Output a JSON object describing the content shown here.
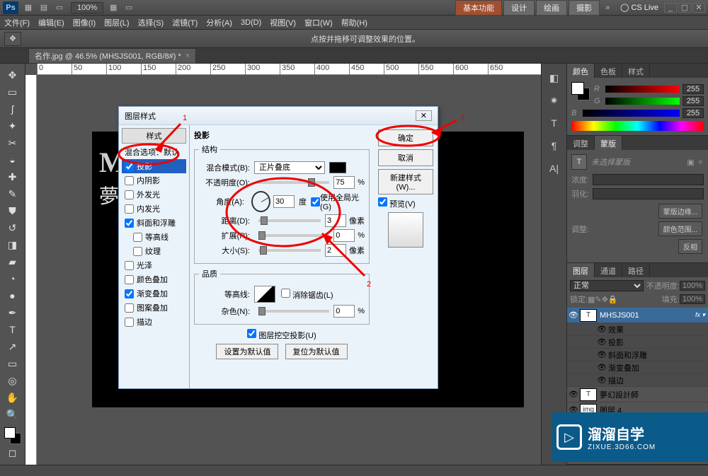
{
  "topbar": {
    "zoom": "100%",
    "cslive": "CS Live"
  },
  "topbar_buttons": {
    "basic": "基本功能",
    "design": "设计",
    "draw": "绘画",
    "photo": "摄影"
  },
  "menu": [
    "文件(F)",
    "编辑(E)",
    "图像(I)",
    "图层(L)",
    "选择(S)",
    "滤镜(T)",
    "分析(A)",
    "3D(D)",
    "视图(V)",
    "窗口(W)",
    "帮助(H)"
  ],
  "optbar_hint": "点按并拖移可调整效果的位置。",
  "doctab": "名作.jpg @ 46.5% (MHSJS001, RGB/8#) *",
  "panels": {
    "color_tabs": [
      "颜色",
      "色板",
      "样式"
    ],
    "rgb": {
      "r": "255",
      "g": "255",
      "b": "255"
    },
    "adjust_tabs": [
      "调整",
      "蒙版"
    ],
    "mask_placeholder": "未选择蒙版",
    "mask_fields": {
      "density": "浓度:",
      "feather": "羽化:",
      "adjust": "调整:"
    },
    "mask_buttons": {
      "edge": "蒙版边缘...",
      "range": "颜色范围...",
      "invert": "反相"
    },
    "layer_tabs": [
      "图层",
      "通道",
      "路径"
    ],
    "blend": "正常",
    "opacity_label": "不透明度:",
    "opacity": "100%",
    "lock": "锁定:",
    "fill_label": "填充:",
    "fill": "100%",
    "layers": [
      {
        "name": "MHSJS001",
        "thumb": "T",
        "sel": true,
        "fx": "fx"
      },
      {
        "name": "效果",
        "sub": true
      },
      {
        "name": "投影",
        "sub": true
      },
      {
        "name": "斜面和浮雕",
        "sub": true
      },
      {
        "name": "渐变叠加",
        "sub": true
      },
      {
        "name": "描边",
        "sub": true
      },
      {
        "name": "夢幻設計師",
        "thumb": "T"
      },
      {
        "name": "图层 4",
        "thumb": "img"
      }
    ]
  },
  "dialog": {
    "title": "图层样式",
    "styles_header": "样式",
    "blend_options": "混合选项：默认",
    "items": [
      {
        "label": "投影",
        "checked": true,
        "sel": true
      },
      {
        "label": "内阴影",
        "checked": false
      },
      {
        "label": "外发光",
        "checked": false
      },
      {
        "label": "内发光",
        "checked": false
      },
      {
        "label": "斜面和浮雕",
        "checked": true
      },
      {
        "label": "等高线",
        "checked": false,
        "indent": true
      },
      {
        "label": "纹理",
        "checked": false,
        "indent": true
      },
      {
        "label": "光泽",
        "checked": false
      },
      {
        "label": "颜色叠加",
        "checked": false
      },
      {
        "label": "渐变叠加",
        "checked": true
      },
      {
        "label": "图案叠加",
        "checked": false
      },
      {
        "label": "描边",
        "checked": false
      }
    ],
    "section_title": "投影",
    "struct": "结构",
    "blend_mode_label": "混合模式(B):",
    "blend_mode": "正片叠底",
    "opacity_label": "不透明度(O):",
    "opacity": "75",
    "pct": "%",
    "angle_label": "角度(A):",
    "angle": "30",
    "degree": "度",
    "global": "使用全局光(G)",
    "distance_label": "距离(D):",
    "distance": "3",
    "px": "像素",
    "spread_label": "扩展(R):",
    "spread": "0",
    "size_label": "大小(S):",
    "size": "2",
    "quality": "品质",
    "contour_label": "等高线:",
    "antialias": "消除锯齿(L)",
    "noise_label": "杂色(N):",
    "noise": "0",
    "knockout": "图层挖空投影(U)",
    "reset_default": "设置为默认值",
    "restore_default": "复位为默认值",
    "ok": "确定",
    "cancel": "取消",
    "new_style": "新建样式(W)...",
    "preview": "预览(V)"
  },
  "watermark": {
    "line1": "溜溜自学",
    "line2": "ZIXUE.3D66.COM"
  }
}
